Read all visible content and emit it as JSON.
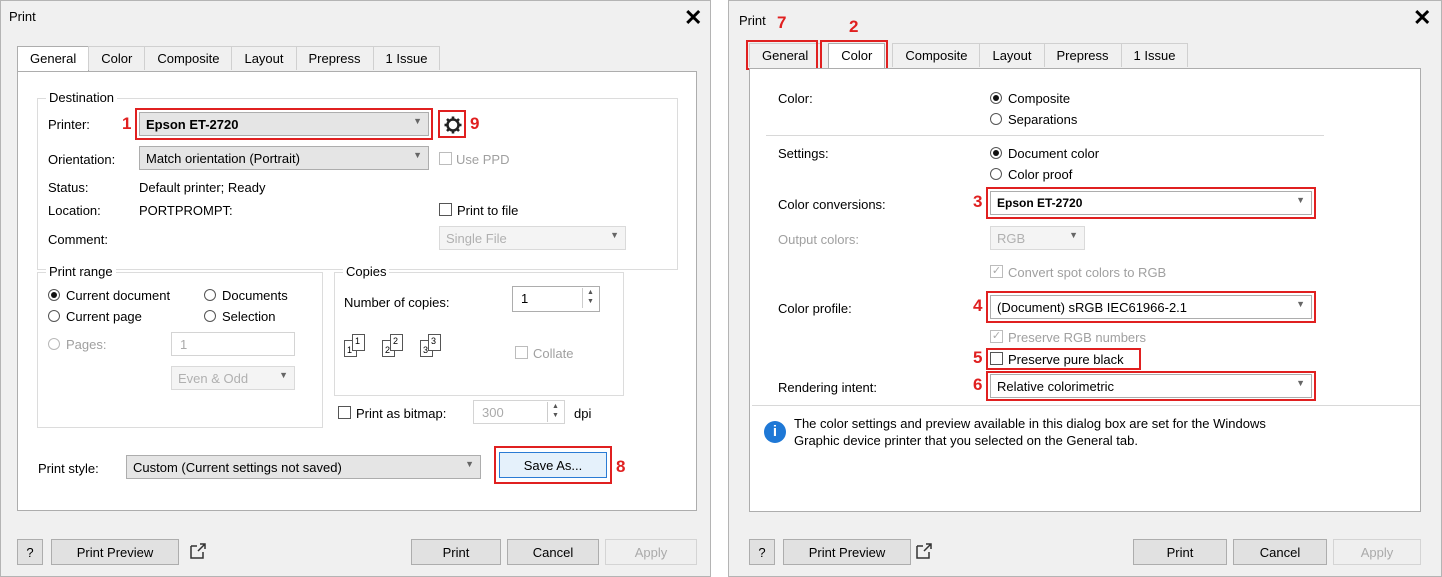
{
  "left": {
    "title": "Print",
    "tabs": [
      "General",
      "Color",
      "Composite",
      "Layout",
      "Prepress",
      "1 Issue"
    ],
    "destination": {
      "legend": "Destination",
      "printer_label": "Printer:",
      "printer_value": "Epson ET-2720",
      "orientation_label": "Orientation:",
      "orientation_value": "Match orientation (Portrait)",
      "use_ppd": "Use PPD",
      "status_label": "Status:",
      "status_value": "Default printer; Ready",
      "location_label": "Location:",
      "location_value": "PORTPROMPT:",
      "print_to_file": "Print to file",
      "comment_label": "Comment:",
      "file_option": "Single File"
    },
    "print_range": {
      "legend": "Print range",
      "current_document": "Current document",
      "documents": "Documents",
      "current_page": "Current page",
      "selection": "Selection",
      "pages": "Pages:",
      "pages_value": "1",
      "even_odd": "Even & Odd"
    },
    "copies": {
      "legend": "Copies",
      "number_label": "Number of copies:",
      "number_value": "1",
      "collate": "Collate",
      "icon_digits": [
        "1",
        "1",
        "2",
        "2",
        "3",
        "3"
      ]
    },
    "bitmap": {
      "label": "Print as bitmap:",
      "value": "300",
      "unit": "dpi"
    },
    "print_style": {
      "label": "Print style:",
      "value": "Custom (Current settings not saved)",
      "save_as": "Save As..."
    },
    "footer": {
      "help": "?",
      "preview": "Print Preview",
      "print": "Print",
      "cancel": "Cancel",
      "apply": "Apply"
    },
    "annotations": [
      "1",
      "8",
      "9"
    ]
  },
  "right": {
    "title": "Print",
    "tabs": [
      "General",
      "Color",
      "Composite",
      "Layout",
      "Prepress",
      "1 Issue"
    ],
    "color_label": "Color:",
    "composite": "Composite",
    "separations": "Separations",
    "settings_label": "Settings:",
    "document_color": "Document color",
    "color_proof": "Color proof",
    "conversions_label": "Color conversions:",
    "conversions_value": "Epson ET-2720",
    "output_label": "Output colors:",
    "output_value": "RGB",
    "convert_spot": "Convert spot colors to RGB",
    "profile_label": "Color profile:",
    "profile_value": "(Document) sRGB IEC61966-2.1",
    "preserve_rgb": "Preserve RGB numbers",
    "preserve_black": "Preserve pure black",
    "intent_label": "Rendering intent:",
    "intent_value": "Relative colorimetric",
    "info_icon": "i",
    "info_line1": "The color settings and preview available in this dialog box are set for the Windows",
    "info_line2": "Graphic device printer that you selected on the General tab.",
    "footer": {
      "help": "?",
      "preview": "Print Preview",
      "print": "Print",
      "cancel": "Cancel",
      "apply": "Apply"
    },
    "annotations": [
      "7",
      "2",
      "3",
      "4",
      "5",
      "6"
    ]
  }
}
